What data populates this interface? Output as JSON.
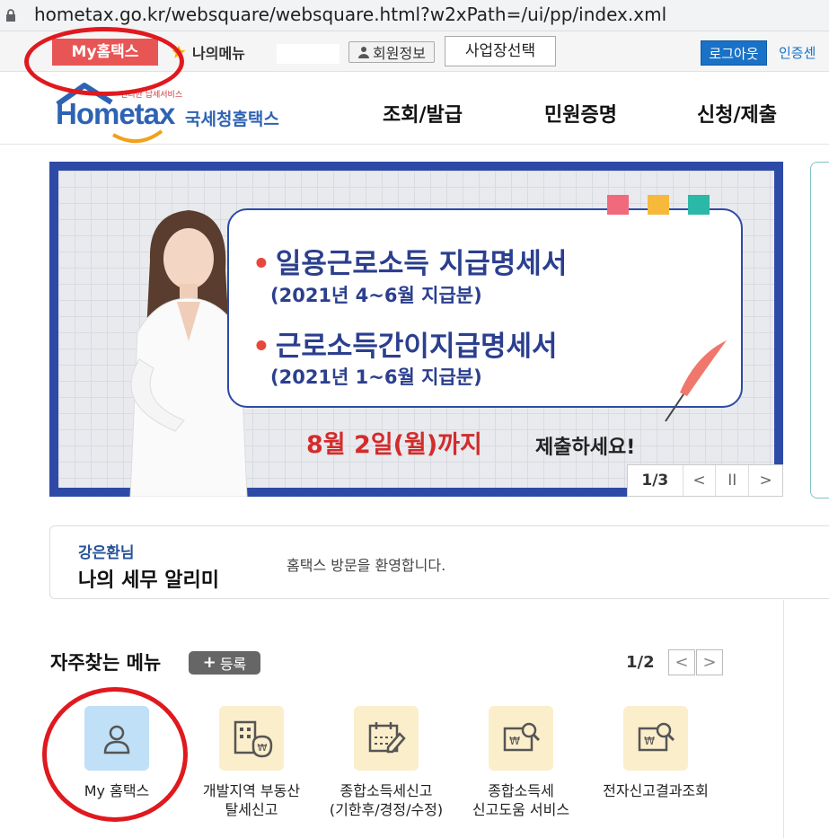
{
  "browser": {
    "url": "hometax.go.kr/websquare/websquare.html?w2xPath=/ui/pp/index.xml"
  },
  "util_bar": {
    "my_hometax": "My홈택스",
    "my_menu": "나의메뉴",
    "member_info": "회원정보",
    "business_select": "사업장선택",
    "logout": "로그아웃",
    "cert_center": "인증센"
  },
  "header": {
    "logo_small": "편리한 납세서비스",
    "logo_text": "Hometax",
    "logo_korean": "국세청홈택스",
    "nav": [
      "조회/발급",
      "민원증명",
      "신청/제출"
    ]
  },
  "banner": {
    "line1": "일용근로소득 지급명세서",
    "line2": "(2021년 4~6월 지급분)",
    "line3": "근로소득간이지급명세서",
    "line4": "(2021년 1~6월 지급분)",
    "deadline_date": "8월 2일(월)까지",
    "deadline_action": "제출하세요!",
    "page_indicator": "1/3",
    "colors": {
      "frame": "#2d4ba6",
      "text": "#2b3f8e",
      "accent_red": "#d42b2b"
    }
  },
  "notifier": {
    "user_name": "강은환님",
    "title": "나의 세무 알리미",
    "welcome": "홈택스 방문을 환영합니다."
  },
  "frequent_menu": {
    "title": "자주찾는 메뉴",
    "register": "등록",
    "page_indicator": "1/2",
    "items": [
      {
        "label": "My 홈택스",
        "icon": "person-icon",
        "color": "#bfe0f7"
      },
      {
        "label": "개발지역 부동산\n탈세신고",
        "icon": "building-money-icon",
        "color": "#fbeecb"
      },
      {
        "label": "종합소득세신고\n(기한후/경정/수정)",
        "icon": "calendar-pen-icon",
        "color": "#fbeecb"
      },
      {
        "label": "종합소득세\n신고도움 서비스",
        "icon": "document-search-icon",
        "color": "#fbeecb"
      },
      {
        "label": "전자신고결과조회",
        "icon": "document-search-icon",
        "color": "#fbeecb"
      }
    ]
  }
}
